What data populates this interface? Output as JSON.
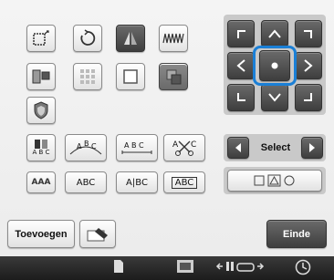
{
  "select_label": "Select",
  "add_button_label": "Toevoegen",
  "end_button_label": "Einde",
  "font_samples": {
    "abc_small": "A B C",
    "abc_arc": "ABC",
    "abc_spaced": "A B C",
    "abc_cut": "ABC",
    "aaa": "AAA",
    "abc_box": "ABC",
    "abc_cursor": "A|BC",
    "abc_boxed": "ABC"
  },
  "colors": {
    "highlight": "#1a7fd6",
    "dark_button": "#4a4a4a"
  }
}
